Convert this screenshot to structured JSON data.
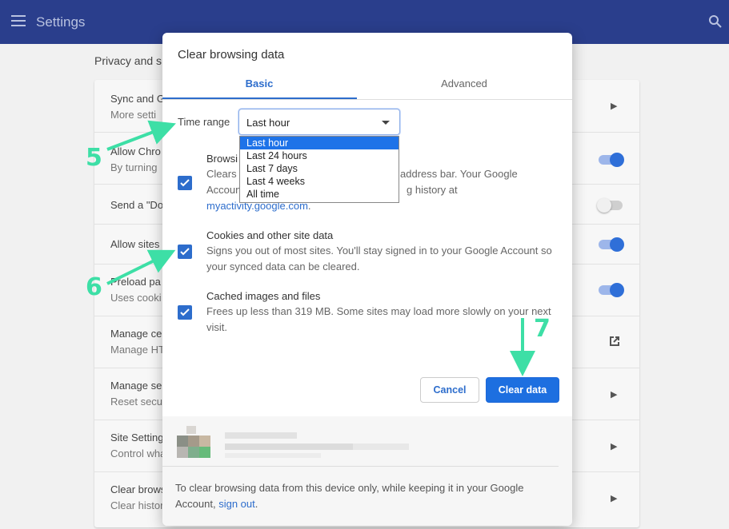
{
  "app": {
    "title": "Settings"
  },
  "settings": {
    "section_title": "Privacy and s",
    "rows": [
      {
        "title": "Sync and G",
        "sub": "More setti",
        "control": "arrow"
      },
      {
        "title": "Allow Chro",
        "sub": "By turning",
        "control": "toggle-on"
      },
      {
        "title": "Send a \"Do",
        "sub": "",
        "control": "toggle-off"
      },
      {
        "title": "Allow sites",
        "sub": "",
        "control": "toggle-on"
      },
      {
        "title": "Preload pa",
        "sub": "Uses cooki",
        "control": "toggle-on"
      },
      {
        "title": "Manage ce",
        "sub": "Manage HT",
        "control": "external"
      },
      {
        "title": "Manage se",
        "sub": "Reset secu",
        "control": "arrow"
      },
      {
        "title": "Site Setting",
        "sub": "Control wha",
        "control": "arrow"
      },
      {
        "title": "Clear brows",
        "sub": "Clear histor",
        "control": "arrow"
      }
    ]
  },
  "dialog": {
    "title": "Clear browsing data",
    "tabs": [
      "Basic",
      "Advanced"
    ],
    "time_range_label": "Time range",
    "time_range_value": "Last hour",
    "time_range_options": [
      "Last hour",
      "Last 24 hours",
      "Last 7 days",
      "Last 4 weeks",
      "All time"
    ],
    "items": [
      {
        "title": "Browsi",
        "desc_line1_left": "Clears",
        "desc_line1_right": "address bar. Your Google",
        "desc_line2_left": "Accoun",
        "desc_line2_right": "g history at",
        "link": "myactivity.google.com",
        "link_suffix": ".",
        "checked": true
      },
      {
        "title": "Cookies and other site data",
        "desc": "Signs you out of most sites. You'll stay signed in to your Google Account so your synced data can be cleared.",
        "checked": true
      },
      {
        "title": "Cached images and files",
        "desc": "Frees up less than 319 MB. Some sites may load more slowly on your next visit.",
        "checked": true
      }
    ],
    "buttons": {
      "cancel": "Cancel",
      "clear": "Clear data"
    },
    "footer": {
      "text_before": "To clear browsing data from this device only, while keeping it in your Google Account,",
      "link": "sign out",
      "text_after": "."
    }
  },
  "annotations": [
    "5",
    "6",
    "7"
  ],
  "colors": {
    "accent": "#2d6dcc",
    "header": "#2a3e8c",
    "annotation": "#3ddfa6"
  }
}
